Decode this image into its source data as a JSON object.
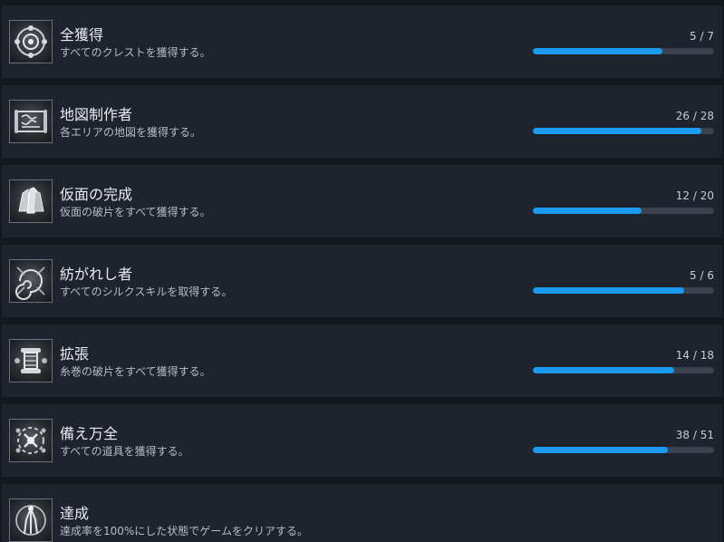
{
  "achievements": [
    {
      "key": "crest",
      "icon": "crest-emblem-icon",
      "title": "全獲得",
      "description": "すべてのクレストを獲得する。",
      "current": 5,
      "total": 7,
      "progress_text": "5 / 7"
    },
    {
      "key": "map",
      "icon": "map-scroll-icon",
      "title": "地図制作者",
      "description": "各エリアの地図を獲得する。",
      "current": 26,
      "total": 28,
      "progress_text": "26 / 28"
    },
    {
      "key": "mask",
      "icon": "mask-shards-icon",
      "title": "仮面の完成",
      "description": "仮面の破片をすべて獲得する。",
      "current": 12,
      "total": 20,
      "progress_text": "12 / 20"
    },
    {
      "key": "silk",
      "icon": "silk-swirl-icon",
      "title": "紡がれし者",
      "description": "すべてのシルクスキルを取得する。",
      "current": 5,
      "total": 6,
      "progress_text": "5 / 6"
    },
    {
      "key": "spool",
      "icon": "spool-ornament-icon",
      "title": "拡張",
      "description": "糸巻の破片をすべて獲得する。",
      "current": 14,
      "total": 18,
      "progress_text": "14 / 18"
    },
    {
      "key": "tools",
      "icon": "tools-wreath-icon",
      "title": "備え万全",
      "description": "すべての道具を獲得する。",
      "current": 38,
      "total": 51,
      "progress_text": "38 / 51"
    },
    {
      "key": "complete",
      "icon": "completion-figure-icon",
      "title": "達成",
      "description": "達成率を100%にした状態でゲームをクリアする。"
    }
  ]
}
